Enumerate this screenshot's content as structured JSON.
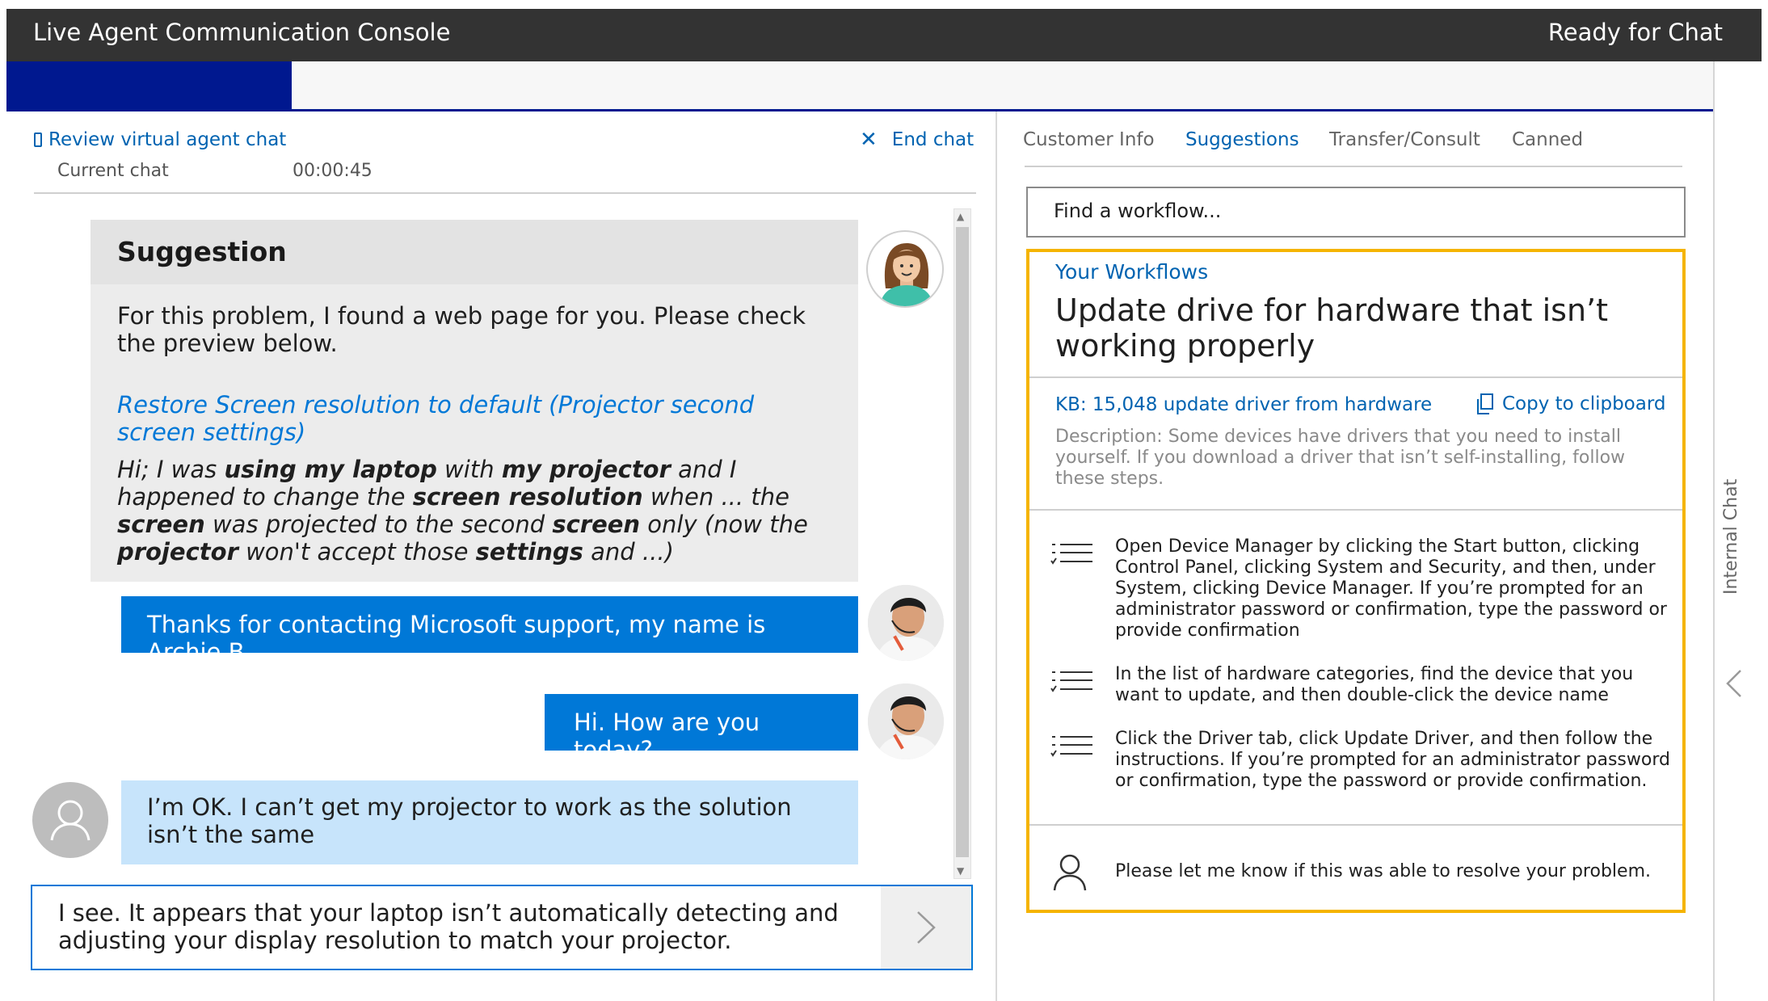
{
  "titlebar": {
    "title": "Live Agent Communication Console",
    "status": "Ready for Chat"
  },
  "rail": {
    "label": "Internal Chat"
  },
  "left_pane": {
    "review_link": "Review virtual agent chat",
    "end_chat": "End chat",
    "current_chat_label": "Current chat",
    "timer": "00:00:45",
    "suggestion": {
      "title": "Suggestion",
      "text": "For this problem, I found a web page for you. Please check the preview below.",
      "link": "Restore Screen resolution to default (Projector second screen settings)",
      "snippet": {
        "p1": "Hi; I was ",
        "b1": "using my laptop",
        "p2": " with ",
        "b2": "my projector",
        "p3": " and I happened to change the ",
        "b3": "screen resolution",
        "p4": " when ... the ",
        "b4": "screen",
        "p5": " was projected to the second ",
        "b5": "screen",
        "p6": " only (now the ",
        "b6": "projector",
        "p7": " won't accept those ",
        "b7": "settings",
        "p8": " and ...)"
      }
    },
    "messages": [
      {
        "sender": "agent",
        "text": "Thanks for contacting Microsoft support, my name is Archie B."
      },
      {
        "sender": "agent",
        "text": "Hi. How are you today?"
      },
      {
        "sender": "customer",
        "text": "I’m OK. I can’t get my projector to work as the solution isn’t the same"
      }
    ],
    "compose_text": "I see. It appears that your laptop isn’t automatically detecting and adjusting your display resolution to match your projector."
  },
  "right_pane": {
    "tabs": [
      "Customer Info",
      "Suggestions",
      "Transfer/Consult",
      "Canned"
    ],
    "active_tab": "Suggestions",
    "search_placeholder": "Find a workflow...",
    "workflow": {
      "label": "Your Workflows",
      "title": "Update drive for hardware that isn’t working properly",
      "kb_link": "KB: 15,048 update driver from hardware",
      "copy_label": "Copy to clipboard",
      "description": "Description: Some devices have drivers that you need to install yourself. If you download a driver that isn’t self-installing, follow these steps.",
      "steps": [
        "Open Device Manager by clicking the Start button, clicking Control Panel, clicking System and Security, and then, under System, clicking Device Manager. If you’re prompted for an administrator password or confirmation, type the password or provide confirmation",
        "In the list of hardware categories, find the device that you want to update, and then double-click the device name",
        "Click the Driver tab, click Update Driver, and then follow the instructions. If you’re prompted for an administrator password or confirmation, type the password or provide confirmation."
      ],
      "closing": "Please let me know if this was able to resolve your problem."
    }
  },
  "colors": {
    "titlebar_bg": "#333333",
    "accent_navy": "#00188f",
    "agent_bubble": "#0078d7",
    "customer_bubble": "#c7e4fb",
    "link_blue": "#0063b1",
    "workflow_border": "#f5b400"
  }
}
